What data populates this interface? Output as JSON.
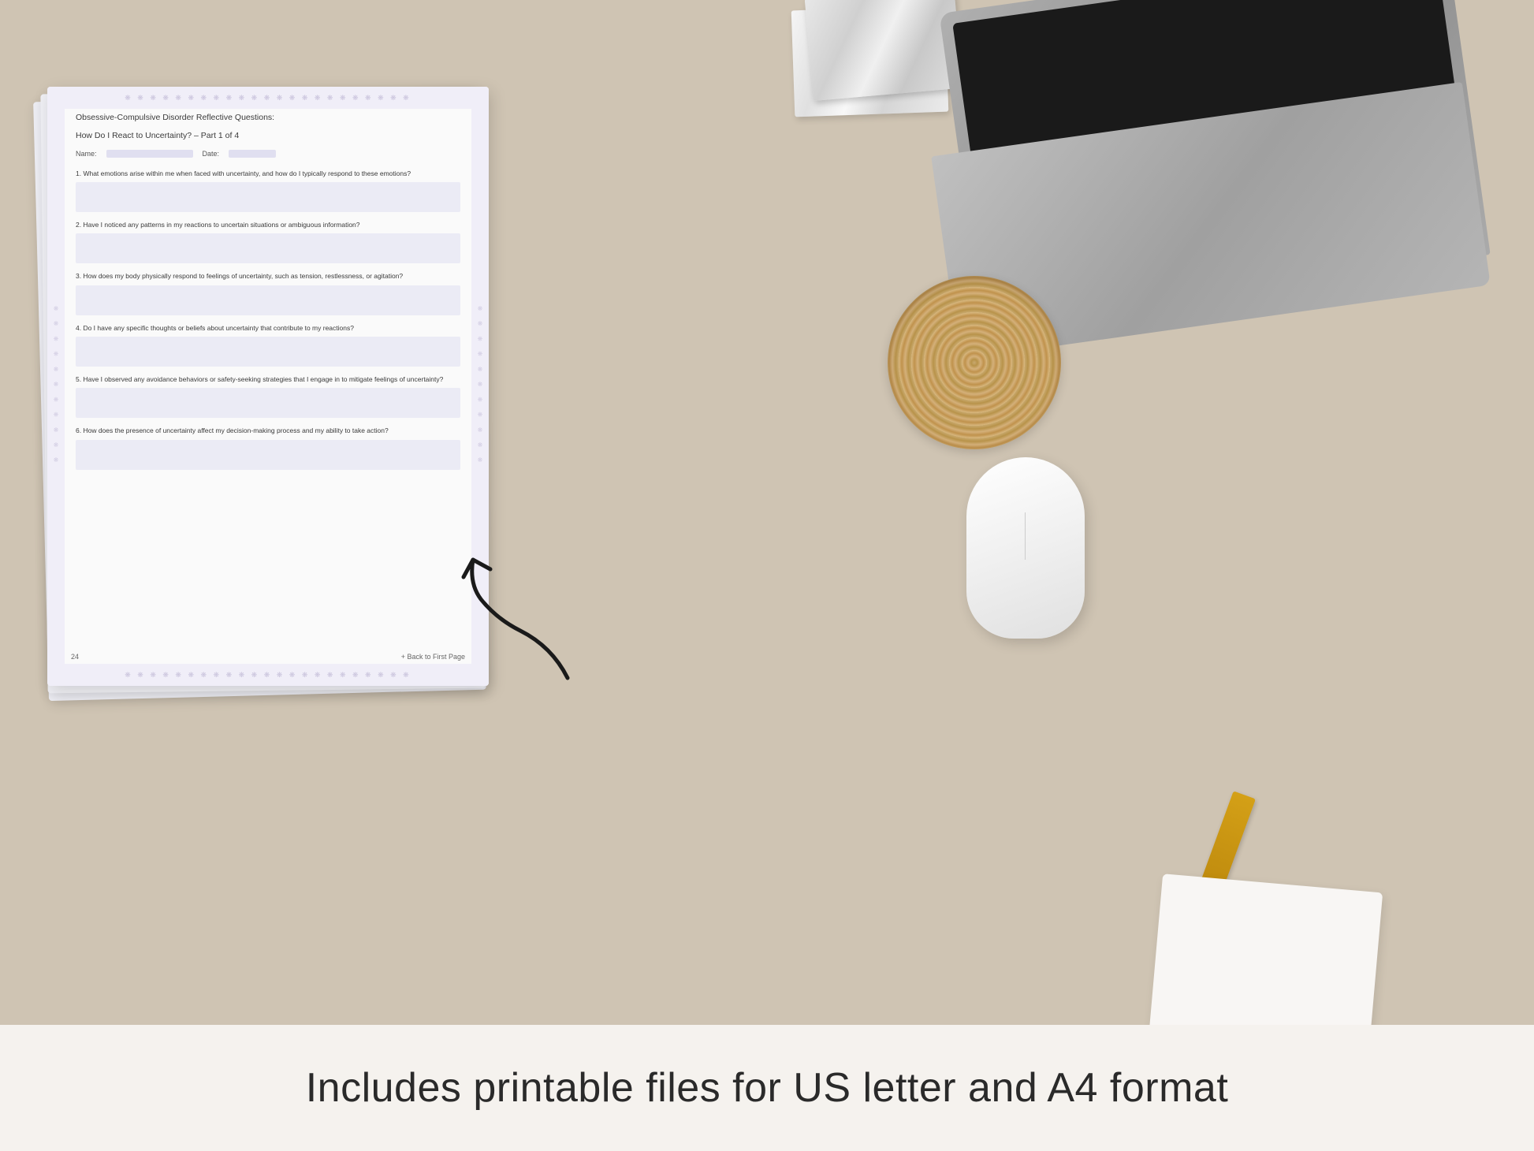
{
  "background": {
    "color": "#cfc4b3"
  },
  "bottom_bar": {
    "text": "Includes printable files for US letter and A4 format",
    "background": "#f5f2ee"
  },
  "document": {
    "title_line1": "Obsessive-Compulsive Disorder Reflective Questions:",
    "title_line2": "How Do I React to Uncertainty?  – Part 1 of 4",
    "name_label": "Name:",
    "date_label": "Date:",
    "questions": [
      {
        "number": "1.",
        "text": "What emotions arise within me when faced with uncertainty, and how do I typically respond to these emotions?"
      },
      {
        "number": "2.",
        "text": "Have I noticed any patterns in my reactions to uncertain situations or ambiguous information?"
      },
      {
        "number": "3.",
        "text": "How does my body physically respond to feelings of uncertainty, such as tension, restlessness, or agitation?"
      },
      {
        "number": "4.",
        "text": "Do I have any specific thoughts or beliefs about uncertainty that contribute to my reactions?"
      },
      {
        "number": "5.",
        "text": "Have I observed any avoidance behaviors or safety-seeking strategies that I engage in to mitigate feelings of uncertainty?"
      },
      {
        "number": "6.",
        "text": "How does the presence of uncertainty affect my decision-making process and my ability to take action?"
      }
    ],
    "page_number": "24",
    "back_link": "+ Back to First Page"
  },
  "arrow": {
    "color": "#1a1a1a"
  }
}
